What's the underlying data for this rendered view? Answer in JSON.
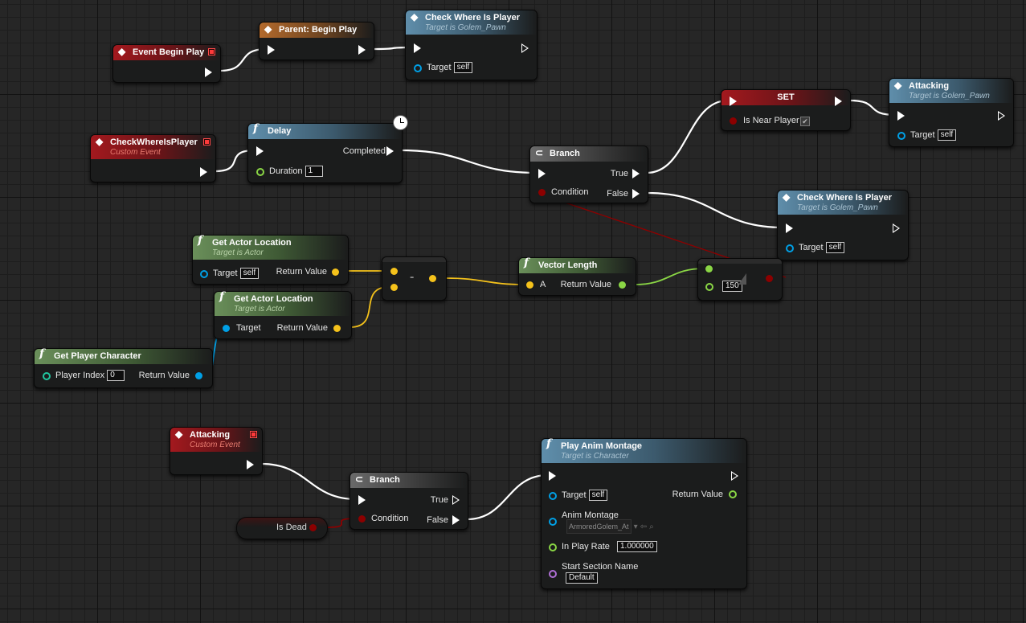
{
  "event_begin_play": {
    "title": "Event Begin Play"
  },
  "parent_begin_play": {
    "title": "Parent: Begin Play"
  },
  "check_where_top": {
    "title": "Check Where Is Player",
    "subtitle": "Target is Golem_Pawn",
    "target_label": "Target",
    "target_value": "self"
  },
  "custom_check": {
    "title": "CheckWhereIsPlayer",
    "subtitle": "Custom Event"
  },
  "delay": {
    "title": "Delay",
    "completed": "Completed",
    "duration_label": "Duration",
    "duration_value": "1"
  },
  "branch_top": {
    "title": "Branch",
    "true_label": "True",
    "false_label": "False",
    "condition_label": "Condition"
  },
  "set_node": {
    "title": "SET",
    "var_label": "Is Near Player",
    "checked": "✔"
  },
  "attacking_call": {
    "title": "Attacking",
    "subtitle": "Target is Golem_Pawn",
    "target_label": "Target",
    "target_value": "self"
  },
  "check_where_mid": {
    "title": "Check Where Is Player",
    "subtitle": "Target is Golem_Pawn",
    "target_label": "Target",
    "target_value": "self"
  },
  "get_actor_loc1": {
    "title": "Get Actor Location",
    "subtitle": "Target is Actor",
    "target_label": "Target",
    "target_value": "self",
    "return_label": "Return Value"
  },
  "get_actor_loc2": {
    "title": "Get Actor Location",
    "subtitle": "Target is Actor",
    "target_label": "Target",
    "return_label": "Return Value"
  },
  "subtract": {
    "symbol": "-"
  },
  "vector_length": {
    "title": "Vector Length",
    "a_label": "A",
    "return_label": "Return Value"
  },
  "compare": {
    "value": "150"
  },
  "get_player_char": {
    "title": "Get Player Character",
    "index_label": "Player Index",
    "index_value": "0",
    "return_label": "Return Value"
  },
  "attacking_event": {
    "title": "Attacking",
    "subtitle": "Custom Event"
  },
  "branch_bottom": {
    "title": "Branch",
    "true_label": "True",
    "false_label": "False",
    "condition_label": "Condition"
  },
  "is_dead": {
    "label": "Is Dead"
  },
  "play_anim": {
    "title": "Play Anim Montage",
    "subtitle": "Target is Character",
    "target_label": "Target",
    "target_value": "self",
    "return_label": "Return Value",
    "montage_label": "Anim Montage",
    "montage_value": "ArmoredGolem_At",
    "rate_label": "In Play Rate",
    "rate_value": "1.000000",
    "section_label": "Start Section Name",
    "section_value": "Default"
  },
  "colors": {
    "exec": "#ffffff",
    "bool": "#8c0000",
    "vector": "#f5c21b",
    "object": "#00a0e6",
    "float": "#8ad645",
    "name": "#b06fd6",
    "int": "#21c7a0"
  }
}
